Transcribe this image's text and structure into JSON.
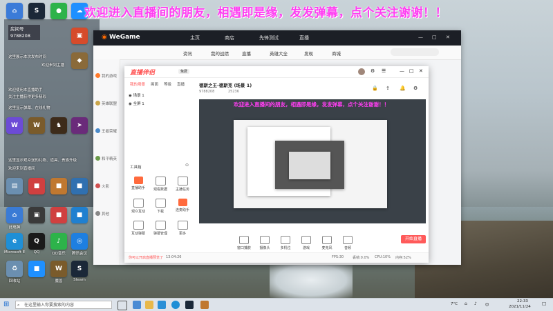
{
  "desktop": {
    "banner": "欢迎进入直播间的朋友，相遇即是缘，发发弹幕，点个关注谢谢！！",
    "room_label": "房间号",
    "room_id": "9788208",
    "side_lines": [
      "这里展示本次发布时间",
      "欢迎来到主播",
      "欢迎使用本直播助手",
      "关注主播获得更多精彩",
      "这里显示弹幕、在线礼物",
      "这里显示观众送的礼物、道具、贵族升级",
      "欢迎来到直播间"
    ],
    "icons": [
      {
        "label": "此电脑",
        "color": "#3a7bd5"
      },
      {
        "label": "Microsoft Edge",
        "color": "#1f8fd6"
      },
      {
        "label": "QQ",
        "color": "#1a1a1a"
      },
      {
        "label": "回收站",
        "color": "#6b8fb0"
      },
      {
        "label": "魔兽",
        "color": "#7a5b2b"
      },
      {
        "label": "Steam",
        "color": "#1b2838"
      },
      {
        "label": "QQ音乐",
        "color": "#2db34a"
      },
      {
        "label": "腾讯会议",
        "color": "#1e7fe0"
      }
    ]
  },
  "wegame": {
    "logo": "WeGame",
    "tabs": [
      "主页",
      "商店",
      "先锋测试",
      "直播"
    ],
    "subtabs": [
      "资讯",
      "我的战绩",
      "直播",
      "英雄大全",
      "发现",
      "商城"
    ],
    "left_items": [
      "我的游戏",
      "英雄联盟",
      "王者荣耀",
      "和平精英",
      "火影",
      "其他"
    ]
  },
  "obs": {
    "logo": "直播伴侣",
    "tag": "免费",
    "title": "德斯之王-德斯克 (场景 1)",
    "room": "9788208",
    "viewers": "25236",
    "tabs": [
      "我的场景",
      "画面",
      "等级",
      "直播"
    ],
    "scenes": [
      "场景 1",
      "全屏 1"
    ],
    "tools_label": "工具箱",
    "tools": [
      "直播助手",
      "观看数据",
      "主播任务",
      "观众互动",
      "下载",
      "连麦助手",
      "互动弹幕",
      "弹幕管理",
      "更多"
    ],
    "bottom_tools": [
      "窗口捕获",
      "摄像头",
      "多机位",
      "游戏",
      "麦克风",
      "音频"
    ],
    "start_label": "开始直播",
    "status": [
      "CPU:10%",
      "内存:52%",
      "FPS:30",
      "丢帧:0.0%"
    ],
    "footer_note": "你可以开启直播预览了",
    "counter": "13:04:26"
  },
  "taskbar": {
    "search_placeholder": "在这里输入你要搜索的内容",
    "temp": "7°C",
    "time": "22:33",
    "date": "2021/11/24",
    "ime": "中"
  }
}
